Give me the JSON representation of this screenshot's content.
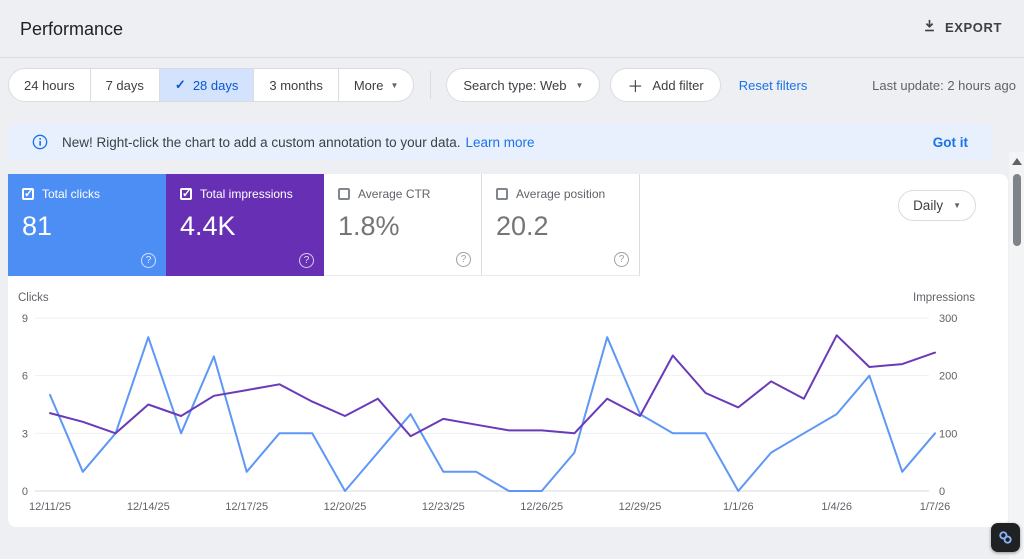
{
  "header": {
    "title": "Performance",
    "export_label": "EXPORT"
  },
  "toolbar": {
    "date_ranges": [
      {
        "label": "24 hours",
        "selected": false
      },
      {
        "label": "7 days",
        "selected": false
      },
      {
        "label": "28 days",
        "selected": true
      },
      {
        "label": "3 months",
        "selected": false
      },
      {
        "label": "More",
        "selected": false
      }
    ],
    "search_type_label": "Search type: Web",
    "add_filter_label": "Add filter",
    "reset_filters_label": "Reset filters",
    "last_update": "Last update: 2 hours ago"
  },
  "banner": {
    "text": "New! Right-click the chart to add a custom annotation to your data.",
    "link_label": "Learn more",
    "dismiss_label": "Got it"
  },
  "metrics": {
    "granularity": "Daily",
    "tiles": [
      {
        "label": "Total clicks",
        "value": "81",
        "checked": true,
        "color": "#4d8ef5"
      },
      {
        "label": "Total impressions",
        "value": "4.4K",
        "checked": true,
        "color": "#672fb4"
      },
      {
        "label": "Average CTR",
        "value": "1.8%",
        "checked": false,
        "color": "#ffffff"
      },
      {
        "label": "Average position",
        "value": "20.2",
        "checked": false,
        "color": "#ffffff"
      }
    ]
  },
  "chart_data": {
    "type": "line",
    "x": [
      "12/11/25",
      "12/12/25",
      "12/13/25",
      "12/14/25",
      "12/15/25",
      "12/16/25",
      "12/17/25",
      "12/18/25",
      "12/19/25",
      "12/20/25",
      "12/21/25",
      "12/22/25",
      "12/23/25",
      "12/24/25",
      "12/25/25",
      "12/26/25",
      "12/27/25",
      "12/28/25",
      "12/29/25",
      "12/30/25",
      "12/31/25",
      "1/1/26",
      "1/2/26",
      "1/3/26",
      "1/4/26",
      "1/5/26",
      "1/6/26",
      "1/7/26"
    ],
    "x_tick_labels": [
      "12/11/25",
      "12/14/25",
      "12/17/25",
      "12/20/25",
      "12/23/25",
      "12/26/25",
      "12/29/25",
      "1/1/26",
      "1/4/26",
      "1/7/26"
    ],
    "x_tick_every": 3,
    "series": [
      {
        "name": "Clicks",
        "axis": "left",
        "color": "#5e97f6",
        "values": [
          5,
          1,
          3,
          8,
          3,
          7,
          1,
          3,
          3,
          0,
          2,
          4,
          1,
          1,
          0,
          0,
          2,
          8,
          4,
          3,
          3,
          0,
          2,
          3,
          4,
          6,
          1,
          3
        ]
      },
      {
        "name": "Impressions",
        "axis": "right",
        "color": "#6a3ab9",
        "values": [
          135,
          120,
          100,
          150,
          130,
          165,
          175,
          185,
          155,
          130,
          160,
          95,
          125,
          115,
          105,
          105,
          100,
          160,
          130,
          235,
          170,
          145,
          190,
          160,
          270,
          215,
          220,
          240
        ]
      }
    ],
    "left_axis": {
      "label": "Clicks",
      "ticks": [
        0,
        3,
        6,
        9
      ],
      "range": [
        0,
        9
      ]
    },
    "right_axis": {
      "label": "Impressions",
      "ticks": [
        0,
        100,
        200,
        300
      ],
      "range": [
        0,
        300
      ]
    },
    "grid": "horizontal",
    "legend_position": "none"
  }
}
